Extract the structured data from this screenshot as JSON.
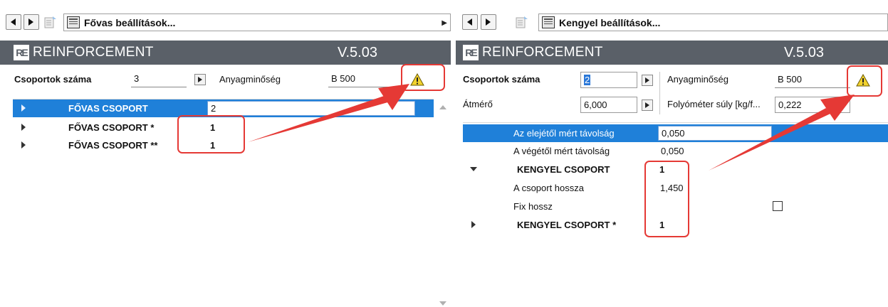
{
  "left": {
    "title": "Fővas beállítások...",
    "brand": "REINFORCEMENT",
    "logo": "RE",
    "version": "V.5.03",
    "group_count_label": "Csoportok száma",
    "group_count_value": "3",
    "material_label": "Anyagminőség",
    "material_value": "B 500",
    "rows": [
      {
        "label": "FŐVAS CSOPORT",
        "value": "2"
      },
      {
        "label": "FŐVAS CSOPORT *",
        "value": "1"
      },
      {
        "label": "FŐVAS CSOPORT **",
        "value": "1"
      }
    ]
  },
  "right": {
    "title": "Kengyel beállítások...",
    "brand": "REINFORCEMENT",
    "logo": "RE",
    "version": "V.5.03",
    "group_count_label": "Csoportok száma",
    "group_count_value": "2",
    "material_label": "Anyagminőség",
    "material_value": "B 500",
    "diameter_label": "Átmérő",
    "diameter_value": "6,000",
    "weight_label": "Folyóméter súly [kg/f...",
    "weight_value": "0,222",
    "rows": [
      {
        "label": "Az elejétől mért távolság",
        "value": "0,050"
      },
      {
        "label": "A végétől mért távolság",
        "value": "0,050"
      },
      {
        "label": "KENGYEL CSOPORT",
        "value": "1"
      },
      {
        "label": "A csoport hossza",
        "value": "1,450"
      },
      {
        "label": "Fix hossz",
        "value": ""
      },
      {
        "label": "KENGYEL CSOPORT *",
        "value": "1"
      }
    ]
  },
  "colors": {
    "header": "#5a6068",
    "selection": "#1f80d9",
    "annotation": "#e53935",
    "warning": "#f2d22e"
  },
  "icons": [
    "back-icon",
    "forward-icon",
    "settings-doc-icon",
    "table-icon",
    "warning-icon",
    "stepper-icon",
    "expand-icon",
    "collapse-icon"
  ]
}
